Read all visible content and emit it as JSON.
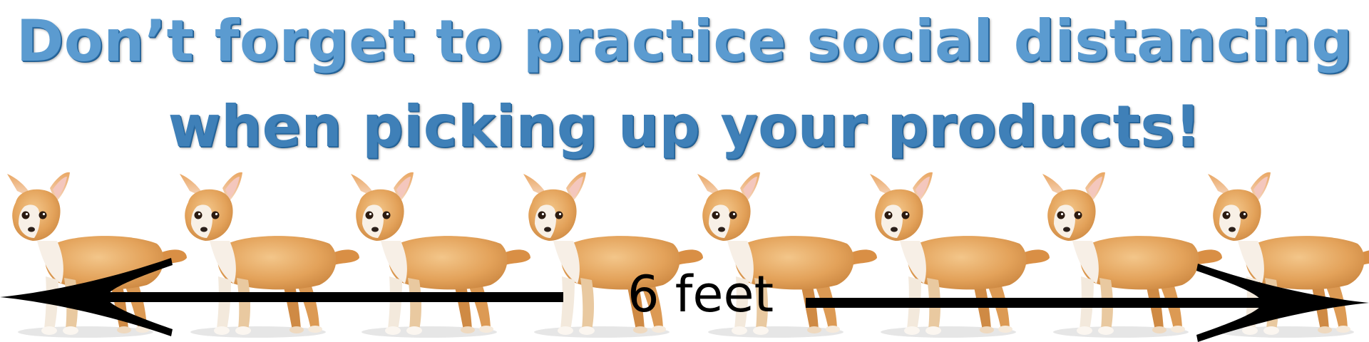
{
  "headline": {
    "line1": "Don’t forget to practice social distancing",
    "line2": "when picking up your products!"
  },
  "distance": {
    "label": "6 feet"
  },
  "illustration": {
    "subject_icon": "chihuahua-dog-icon",
    "count": 8
  },
  "colors": {
    "headline_light": "#5b9bd0",
    "headline_dark": "#3f80b8",
    "dog_fur": "#e8a960",
    "arrow": "#000000"
  }
}
